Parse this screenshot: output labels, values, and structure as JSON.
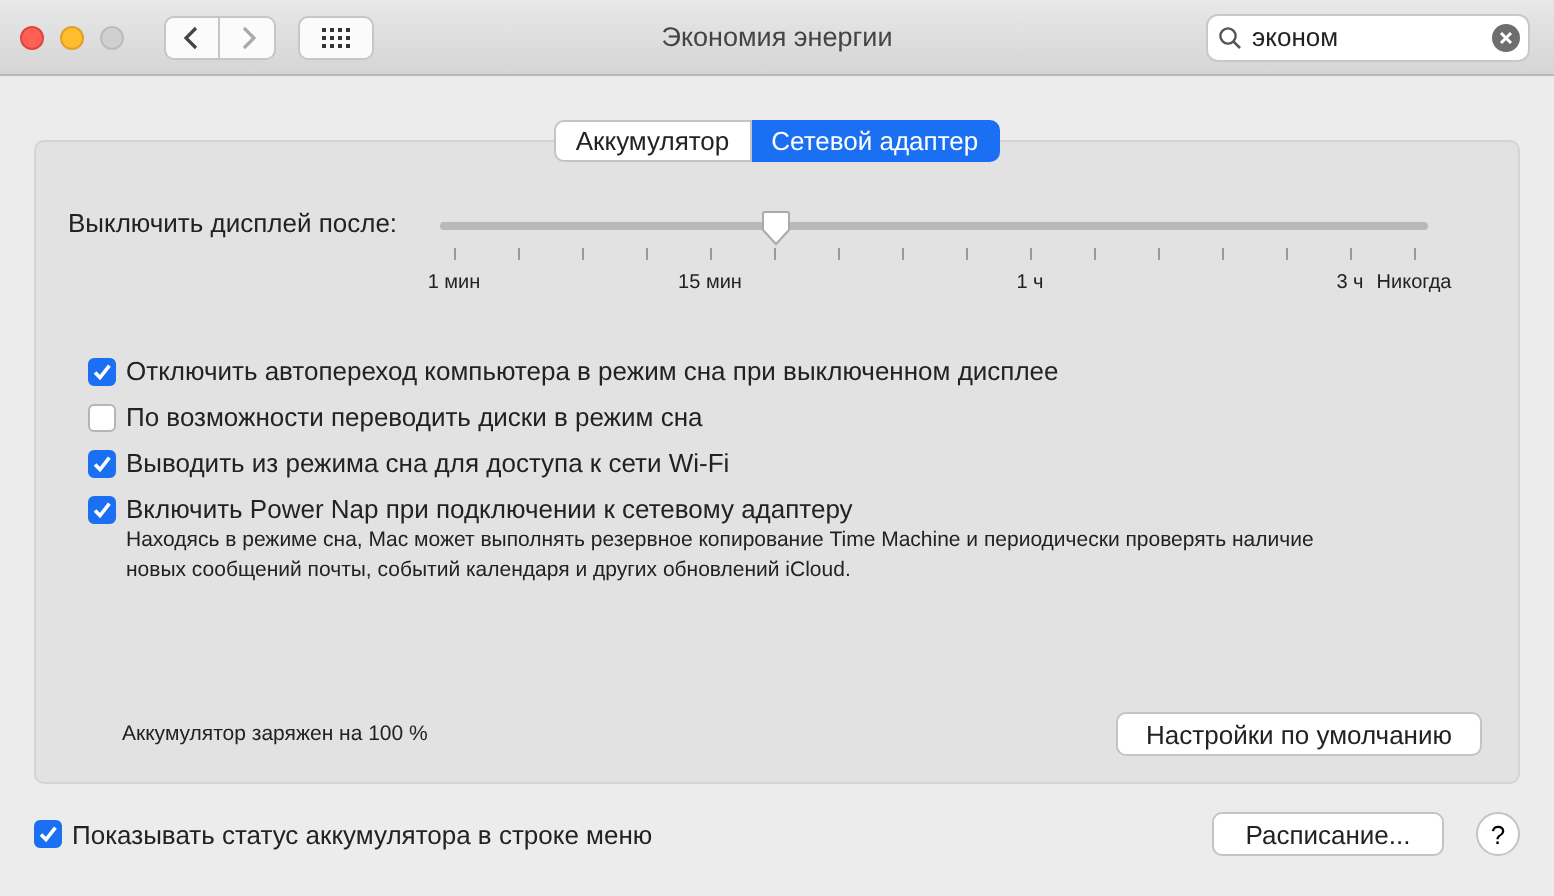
{
  "window": {
    "title": "Экономия энергии"
  },
  "search": {
    "value": "эконом"
  },
  "tabs": [
    {
      "label": "Аккумулятор",
      "selected": false
    },
    {
      "label": "Сетевой адаптер",
      "selected": true
    }
  ],
  "display_sleep": {
    "label": "Выключить дисплей после:",
    "level": 0.34,
    "tick_labels": [
      "1 мин",
      "15 мин",
      "1 ч",
      "3 ч",
      "Никогда"
    ]
  },
  "options": [
    {
      "label": "Отключить автопереход компьютера в режим сна при выключенном дисплее",
      "checked": true
    },
    {
      "label": "По возможности переводить диски в режим сна",
      "checked": false
    },
    {
      "label": "Выводить из режима сна для доступа к сети Wi-Fi",
      "checked": true
    },
    {
      "label": "Включить Power Nap при подключении к сетевому адаптеру",
      "checked": true,
      "description": "Находясь в режиме сна, Mac может выполнять резервное копирование Time Machine и периодически проверять наличие новых сообщений почты, событий календаря и других обновлений iCloud."
    }
  ],
  "battery_status": "Аккумулятор заряжен на 100 %",
  "restore_button": "Настройки по умолчанию",
  "show_status": {
    "label": "Показывать статус аккумулятора в строке меню",
    "checked": true
  },
  "schedule_button": "Расписание...",
  "help_button": "?"
}
